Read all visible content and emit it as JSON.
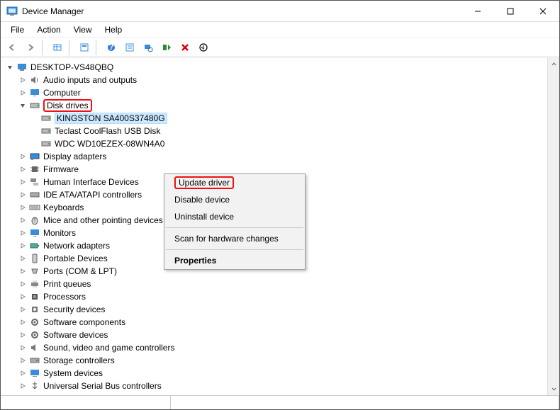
{
  "window": {
    "title": "Device Manager"
  },
  "menu": [
    "File",
    "Action",
    "View",
    "Help"
  ],
  "root": "DESKTOP-VS48QBQ",
  "cats": {
    "audio": "Audio inputs and outputs",
    "computer": "Computer",
    "disk": "Disk drives",
    "disk_children": [
      "KINGSTON SA400S37480G",
      "Teclast CoolFlash USB Disk",
      "WDC WD10EZEX-08WN4A0"
    ],
    "display": "Display adapters",
    "firmware": "Firmware",
    "hid": "Human Interface Devices",
    "ide": "IDE ATA/ATAPI controllers",
    "kbd": "Keyboards",
    "mice": "Mice and other pointing devices",
    "monitors": "Monitors",
    "net": "Network adapters",
    "portable": "Portable Devices",
    "ports": "Ports (COM & LPT)",
    "printq": "Print queues",
    "proc": "Processors",
    "sec": "Security devices",
    "swc": "Software components",
    "swd": "Software devices",
    "sound": "Sound, video and game controllers",
    "storage": "Storage controllers",
    "sysdev": "System devices",
    "usb": "Universal Serial Bus controllers"
  },
  "ctx": {
    "update": "Update driver",
    "disable": "Disable device",
    "uninstall": "Uninstall device",
    "scan": "Scan for hardware changes",
    "props": "Properties"
  },
  "chart_data": null
}
